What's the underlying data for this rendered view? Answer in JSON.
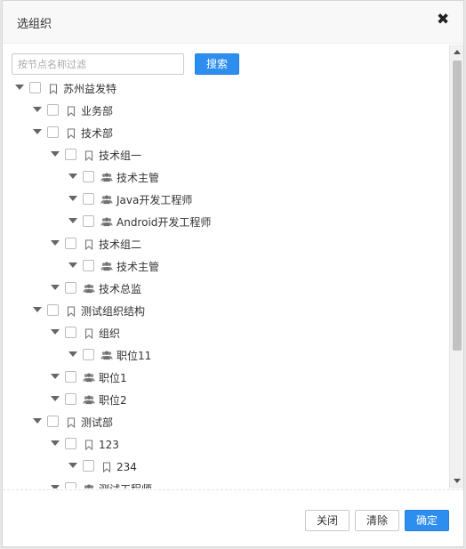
{
  "dialog": {
    "title": "选组织",
    "close_glyph": "✖"
  },
  "search": {
    "placeholder": "按节点名称过滤",
    "button_label": "搜索"
  },
  "tree": [
    {
      "label": "苏州益发特",
      "icon": "bookmark-icon",
      "level": 0
    },
    {
      "label": "业务部",
      "icon": "bookmark-icon",
      "level": 1
    },
    {
      "label": "技术部",
      "icon": "bookmark-icon",
      "level": 1
    },
    {
      "label": "技术组一",
      "icon": "bookmark-icon",
      "level": 2
    },
    {
      "label": "技术主管",
      "icon": "users-icon",
      "level": 3
    },
    {
      "label": "Java开发工程师",
      "icon": "users-icon",
      "level": 3
    },
    {
      "label": "Android开发工程师",
      "icon": "users-icon",
      "level": 3
    },
    {
      "label": "技术组二",
      "icon": "bookmark-icon",
      "level": 2
    },
    {
      "label": "技术主管",
      "icon": "users-icon",
      "level": 3
    },
    {
      "label": "技术总监",
      "icon": "users-icon",
      "level": 2
    },
    {
      "label": "测试组织结构",
      "icon": "bookmark-icon",
      "level": 1
    },
    {
      "label": "组织",
      "icon": "bookmark-icon",
      "level": 2
    },
    {
      "label": "职位11",
      "icon": "users-icon",
      "level": 3
    },
    {
      "label": "职位1",
      "icon": "users-icon",
      "level": 2
    },
    {
      "label": "职位2",
      "icon": "users-icon",
      "level": 2
    },
    {
      "label": "测试部",
      "icon": "bookmark-icon",
      "level": 1
    },
    {
      "label": "123",
      "icon": "bookmark-icon",
      "level": 2
    },
    {
      "label": "234",
      "icon": "bookmark-icon",
      "level": 3
    },
    {
      "label": "测试工程师",
      "icon": "users-icon",
      "level": 2
    }
  ],
  "footer": {
    "close_label": "关闭",
    "clear_label": "清除",
    "confirm_label": "确定"
  },
  "colors": {
    "primary": "#2d8ef0",
    "header_bg": "#f8f8f8"
  }
}
